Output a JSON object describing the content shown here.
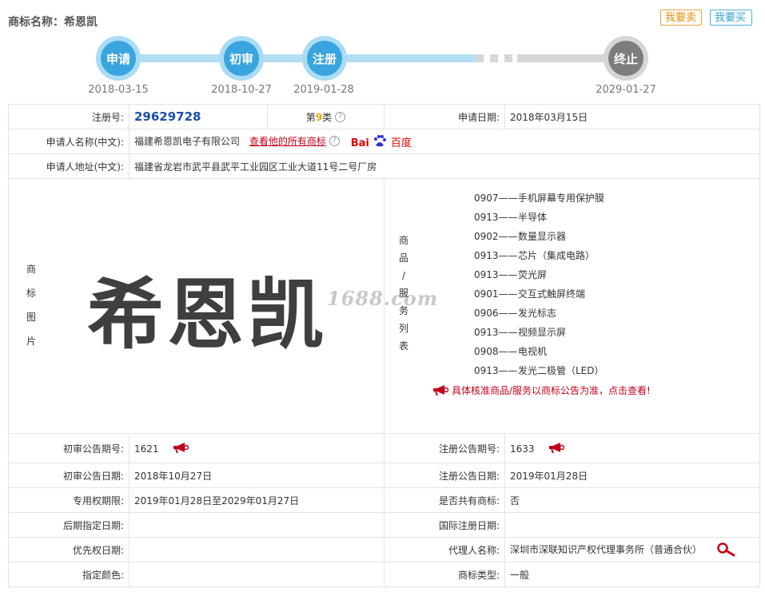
{
  "header": {
    "title": "商标名称：希恩凯"
  },
  "actions": {
    "sell_label": "我要卖",
    "buy_label": "我要买"
  },
  "timeline": {
    "stages": [
      {
        "label": "申请",
        "date": "2018-03-15"
      },
      {
        "label": "初审",
        "date": "2018-10-27"
      },
      {
        "label": "注册",
        "date": "2019-01-28"
      },
      {
        "label": "终止",
        "date": "2029-01-27"
      }
    ]
  },
  "info": {
    "reg_no_label": "注册号:",
    "reg_no": "29629728",
    "class_prefix": "第",
    "class_no": "9",
    "class_suffix": "类",
    "apply_date_label": "申请日期:",
    "apply_date": "2018年03月15日",
    "applicant_label": "申请人名称(中文):",
    "applicant": "福建希恩凯电子有限公司",
    "all_marks_link": "查看他的所有商标",
    "baidu_text": {
      "a": "Bai",
      "b": "百度"
    },
    "address_label": "申请人地址(中文):",
    "address": "福建省龙岩市武平县武平工业园区工业大道11号二号厂房",
    "image_label_chars": [
      "商",
      "标",
      "图",
      "片"
    ],
    "trademark_text": "希恩凯",
    "watermark": "1688.com",
    "goods_label_chars": [
      "商",
      "品",
      "/",
      "服",
      "务",
      "列",
      "表"
    ],
    "goods": [
      {
        "code": "0907——",
        "name": "手机屏幕专用保护膜"
      },
      {
        "code": "0913——",
        "name": "半导体"
      },
      {
        "code": "0902——",
        "name": "数量显示器"
      },
      {
        "code": "0913——",
        "name": "芯片（集成电路）"
      },
      {
        "code": "0913——",
        "name": "荧光屏"
      },
      {
        "code": "0901——",
        "name": "交互式触屏终端"
      },
      {
        "code": "0906——",
        "name": "发光标志"
      },
      {
        "code": "0913——",
        "name": "视频显示屏"
      },
      {
        "code": "0908——",
        "name": "电视机"
      },
      {
        "code": "0913——",
        "name": "发光二极管（LED）"
      }
    ],
    "goods_notice": "具体核准商品/服务以商标公告为准，点击查看!",
    "prelim_no_label": "初审公告期号:",
    "prelim_no": "1621",
    "reg_notice_no_label": "注册公告期号:",
    "reg_notice_no": "1633",
    "prelim_date_label": "初审公告日期:",
    "prelim_date": "2018年10月27日",
    "reg_notice_date_label": "注册公告日期:",
    "reg_notice_date": "2019年01月28日",
    "exclusive_label": "专用权期限:",
    "exclusive": "2019年01月28日至2029年01月27日",
    "shared_label": "是否共有商标:",
    "shared": "否",
    "later_label": "后期指定日期:",
    "later": "",
    "intl_label": "国际注册日期:",
    "intl": "",
    "priority_label": "优先权日期:",
    "priority": "",
    "agent_label": "代理人名称:",
    "agent": "深圳市深联知识产权代理事务所（普通合伙）",
    "color_label": "指定颜色:",
    "color": "",
    "type_label": "商标类型:",
    "type": "一般"
  },
  "colors": {
    "timeline_active": "#3aa4de",
    "timeline_inactive": "#7d7d7d",
    "reg_no": "#1d4fa8",
    "class_no": "#e8a100",
    "link_red": "#c3001b"
  }
}
